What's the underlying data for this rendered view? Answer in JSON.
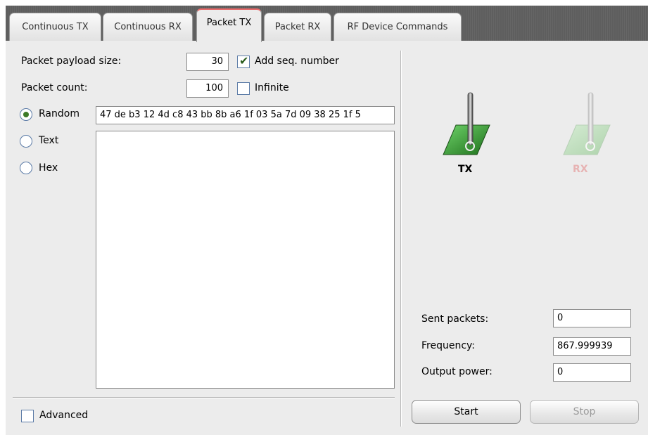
{
  "tabs": [
    {
      "label": "Continuous TX"
    },
    {
      "label": "Continuous RX"
    },
    {
      "label": "Packet TX"
    },
    {
      "label": "Packet RX"
    },
    {
      "label": "RF Device Commands"
    }
  ],
  "form": {
    "payload_size_label": "Packet payload size:",
    "payload_size_value": "30",
    "seq_number_label": "Add seq. number",
    "seq_number_checked": true,
    "packet_count_label": "Packet count:",
    "packet_count_value": "100",
    "infinite_label": "Infinite",
    "infinite_checked": false,
    "data_mode": {
      "options": [
        "Random",
        "Text",
        "Hex"
      ],
      "selected": "Random"
    },
    "random_data": "47 de b3 12 4d c8 43 bb 8b a6 1f 03 5a 7d 09 38 25 1f 5",
    "text_data": "",
    "advanced_label": "Advanced",
    "advanced_checked": false
  },
  "status": {
    "tx_label": "TX",
    "rx_label": "RX",
    "tx_active": true,
    "rx_active": false,
    "sent_packets_label": "Sent packets:",
    "sent_packets_value": "0",
    "frequency_label": "Frequency:",
    "frequency_value": "867.999939",
    "output_power_label": "Output power:",
    "output_power_value": "0"
  },
  "buttons": {
    "start_label": "Start",
    "stop_label": "Stop"
  },
  "colors": {
    "active_tab_accent": "#e86a6a",
    "tx_active_green": "#2f8a2a",
    "rx_inactive_green": "#9ed19a"
  },
  "icons": {
    "tx": "antenna-tx-icon",
    "rx": "antenna-rx-icon"
  }
}
